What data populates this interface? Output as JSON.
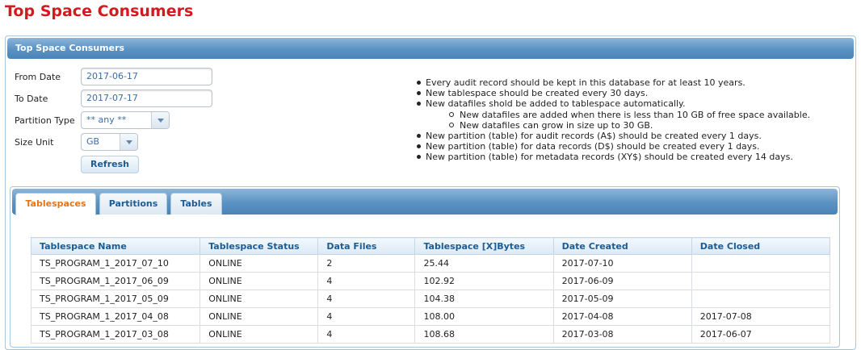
{
  "page_title": "Top Space Consumers",
  "panel_title": "Top Space Consumers",
  "form": {
    "from_date_label": "From Date",
    "from_date_value": "2017-06-17",
    "to_date_label": "To Date",
    "to_date_value": "2017-07-17",
    "partition_type_label": "Partition Type",
    "partition_type_value": "** any **",
    "size_unit_label": "Size Unit",
    "size_unit_value": "GB",
    "refresh_label": "Refresh"
  },
  "notes": [
    {
      "level": 1,
      "text": "Every audit record should be kept in this database for at least 10 years."
    },
    {
      "level": 1,
      "text": "New tablespace should be created every 30 days."
    },
    {
      "level": 1,
      "text": "New datafiles shold be added to tablespace automatically."
    },
    {
      "level": 2,
      "text": "New datafiles are added when there is less than 10 GB of free space available."
    },
    {
      "level": 2,
      "text": "New datafiles can grow in size up to 30 GB."
    },
    {
      "level": 1,
      "text": "New partition (table) for audit records (A$) should be created every 1 days."
    },
    {
      "level": 1,
      "text": "New partition (table) for data records (D$) should be created every 1 days."
    },
    {
      "level": 1,
      "text": "New partition (table) for metadata records (XY$) should be created every 14 days."
    }
  ],
  "tabs": [
    {
      "label": "Tablespaces",
      "active": true
    },
    {
      "label": "Partitions",
      "active": false
    },
    {
      "label": "Tables",
      "active": false
    }
  ],
  "table": {
    "columns": [
      "Tablespace Name",
      "Tablespace Status",
      "Data Files",
      "Tablespace [X]Bytes",
      "Date Created",
      "Date Closed"
    ],
    "rows": [
      [
        "TS_PROGRAM_1_2017_07_10",
        "ONLINE",
        "2",
        "25.44",
        "2017-07-10",
        ""
      ],
      [
        "TS_PROGRAM_1_2017_06_09",
        "ONLINE",
        "4",
        "102.92",
        "2017-06-09",
        ""
      ],
      [
        "TS_PROGRAM_1_2017_05_09",
        "ONLINE",
        "4",
        "104.38",
        "2017-05-09",
        ""
      ],
      [
        "TS_PROGRAM_1_2017_04_08",
        "ONLINE",
        "4",
        "108.00",
        "2017-04-08",
        "2017-07-08"
      ],
      [
        "TS_PROGRAM_1_2017_03_08",
        "ONLINE",
        "4",
        "108.68",
        "2017-03-08",
        "2017-06-07"
      ]
    ]
  },
  "colors": {
    "title_red": "#d4191f",
    "header_blue": "#5a92c3",
    "active_tab_orange": "#e1751a",
    "link_blue": "#1d5b93"
  }
}
